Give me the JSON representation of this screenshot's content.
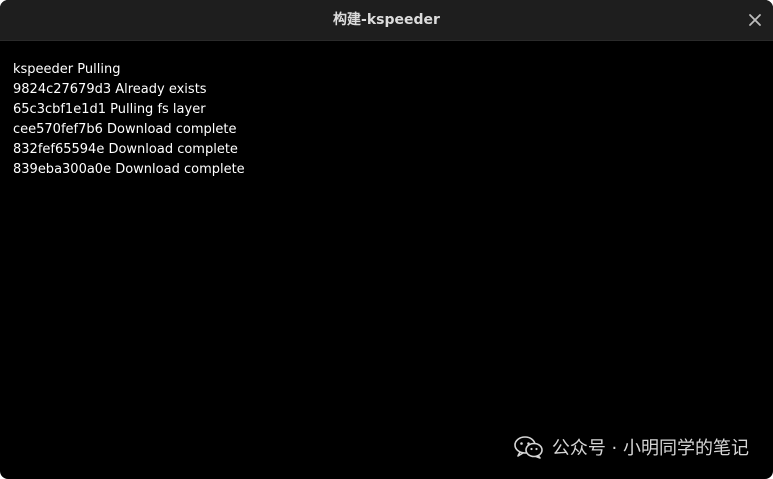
{
  "window": {
    "title": "构建-kspeeder"
  },
  "icons": {
    "close": "close-icon",
    "wechat": "wechat-logo-icon"
  },
  "log": {
    "lines": [
      "kspeeder Pulling",
      "9824c27679d3 Already exists",
      "65c3cbf1e1d1 Pulling fs layer",
      "cee570fef7b6 Download complete",
      "832fef65594e Download complete",
      "839eba300a0e Download complete"
    ]
  },
  "watermark": {
    "text": "公众号 · 小明同学的笔记"
  }
}
